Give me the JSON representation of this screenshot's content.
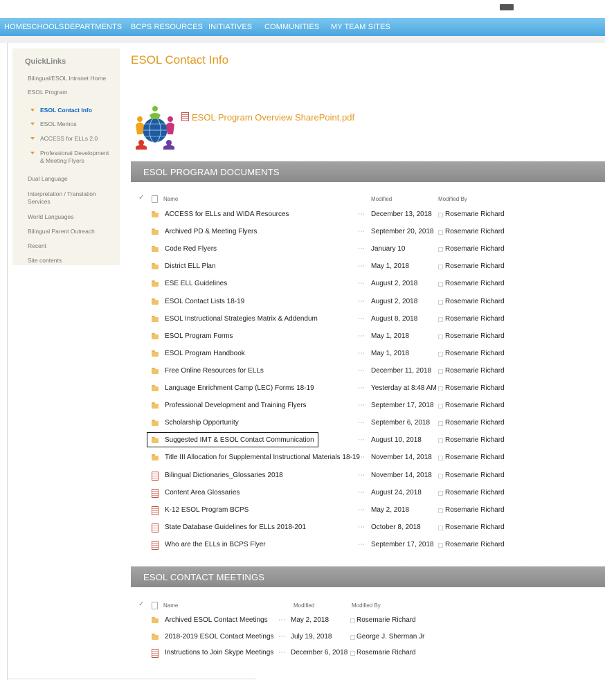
{
  "nav": {
    "items": [
      "HOME",
      "SCHOOLS",
      "DEPARTMENTS",
      "BCPS RESOURCES",
      "INITIATIVES",
      "COMMUNITIES",
      "MY TEAM SITES"
    ]
  },
  "sidebar": {
    "title": "QuickLinks",
    "links": [
      "Bilingual/ESOL Intranet Home",
      "ESOL Program"
    ],
    "sublinks": [
      "ESOL Contact Info",
      "ESOL Memos",
      "ACCESS for ELLs 2.0",
      "Professional Development",
      "& Meeting Flyers"
    ],
    "more_links": [
      "Dual Language",
      "Interpretation / Translation",
      "Services",
      "World Languages",
      "Bilingual Parent Outreach",
      "Recent",
      "Site contents"
    ]
  },
  "page_title": "ESOL Contact Info",
  "pdf_link": "ESOL Program Overview SharePoint.pdf",
  "colors": {
    "nav": "#4aa6df",
    "accent": "#e3971f",
    "active_link": "#0a62c4",
    "section_bar": "#999999"
  },
  "program_documents": {
    "section_title": "ESOL PROGRAM DOCUMENTS",
    "headers": {
      "name": "Name",
      "modified": "Modified",
      "modified_by": "Modified By"
    },
    "rows": [
      {
        "name": "ACCESS for ELLs and WIDA Resources",
        "type": "folder",
        "modified": "December 13, 2018",
        "by": "Rosemarie Richard"
      },
      {
        "name": "Archived PD & Meeting Flyers",
        "type": "folder",
        "modified": "September 20, 2018",
        "by": "Rosemarie Richard"
      },
      {
        "name": "Code Red Flyers",
        "type": "folder",
        "modified": "January 10",
        "by": "Rosemarie Richard"
      },
      {
        "name": "District ELL Plan",
        "type": "folder",
        "modified": "May 1, 2018",
        "by": "Rosemarie Richard"
      },
      {
        "name": "ESE ELL Guidelines",
        "type": "folder",
        "modified": "August 2, 2018",
        "by": "Rosemarie Richard"
      },
      {
        "name": "ESOL Contact Lists 18-19",
        "type": "folder",
        "modified": "August 2, 2018",
        "by": "Rosemarie Richard"
      },
      {
        "name": "ESOL Instructional Strategies Matrix & Addendum",
        "type": "folder",
        "modified": "August 8, 2018",
        "by": "Rosemarie Richard"
      },
      {
        "name": "ESOL Program Forms",
        "type": "folder",
        "modified": "May 1, 2018",
        "by": "Rosemarie Richard"
      },
      {
        "name": "ESOL Program Handbook",
        "type": "folder",
        "modified": "May 1, 2018",
        "by": "Rosemarie Richard"
      },
      {
        "name": "Free Online Resources for ELLs",
        "type": "folder",
        "modified": "December 11, 2018",
        "by": "Rosemarie Richard"
      },
      {
        "name": "Language Enrichment Camp (LEC) Forms 18-19",
        "type": "folder",
        "modified": "Yesterday at 8:48 AM",
        "by": "Rosemarie Richard"
      },
      {
        "name": "Professional Development and Training Flyers",
        "type": "folder",
        "modified": "September 17, 2018",
        "by": "Rosemarie Richard"
      },
      {
        "name": "Scholarship Opportunity",
        "type": "folder",
        "modified": "September 6, 2018",
        "by": "Rosemarie Richard"
      },
      {
        "name": "Suggested IMT & ESOL Contact Communication",
        "type": "folder",
        "modified": "August 10, 2018",
        "by": "Rosemarie Richard"
      },
      {
        "name": "Title III Allocation for Supplemental Instructional Materials 18-19",
        "type": "folder",
        "modified": "November 14, 2018",
        "by": "Rosemarie Richard"
      },
      {
        "name": "Bilingual Dictionaries_Glossaries 2018",
        "type": "pdf",
        "modified": "November 14, 2018",
        "by": "Rosemarie Richard"
      },
      {
        "name": "Content Area Glossaries",
        "type": "pdf",
        "modified": "August 24, 2018",
        "by": "Rosemarie Richard"
      },
      {
        "name": "K-12 ESOL Program BCPS",
        "type": "pdf",
        "modified": "May 2, 2018",
        "by": "Rosemarie Richard"
      },
      {
        "name": "State Database Guidelines for ELLs 2018-201",
        "type": "pdf",
        "modified": "October 8, 2018",
        "by": "Rosemarie Richard"
      },
      {
        "name": "Who are the ELLs in BCPS Flyer",
        "type": "pdf",
        "modified": "September 17, 2018",
        "by": "Rosemarie Richard"
      }
    ]
  },
  "contact_meetings": {
    "section_title": "ESOL CONTACT MEETINGS",
    "headers": {
      "name": "Name",
      "modified": "Modified",
      "modified_by": "Modified By"
    },
    "rows": [
      {
        "name": "Archived ESOL Contact Meetings",
        "type": "folder",
        "modified": "May 2, 2018",
        "by": "Rosemarie Richard"
      },
      {
        "name": "2018-2019 ESOL Contact Meetings",
        "type": "folder",
        "modified": "July 19, 2018",
        "by": "George J. Sherman Jr"
      },
      {
        "name": "Instructions to Join Skype Meetings",
        "type": "pdf",
        "modified": "December 6, 2018",
        "by": "Rosemarie Richard"
      }
    ]
  }
}
